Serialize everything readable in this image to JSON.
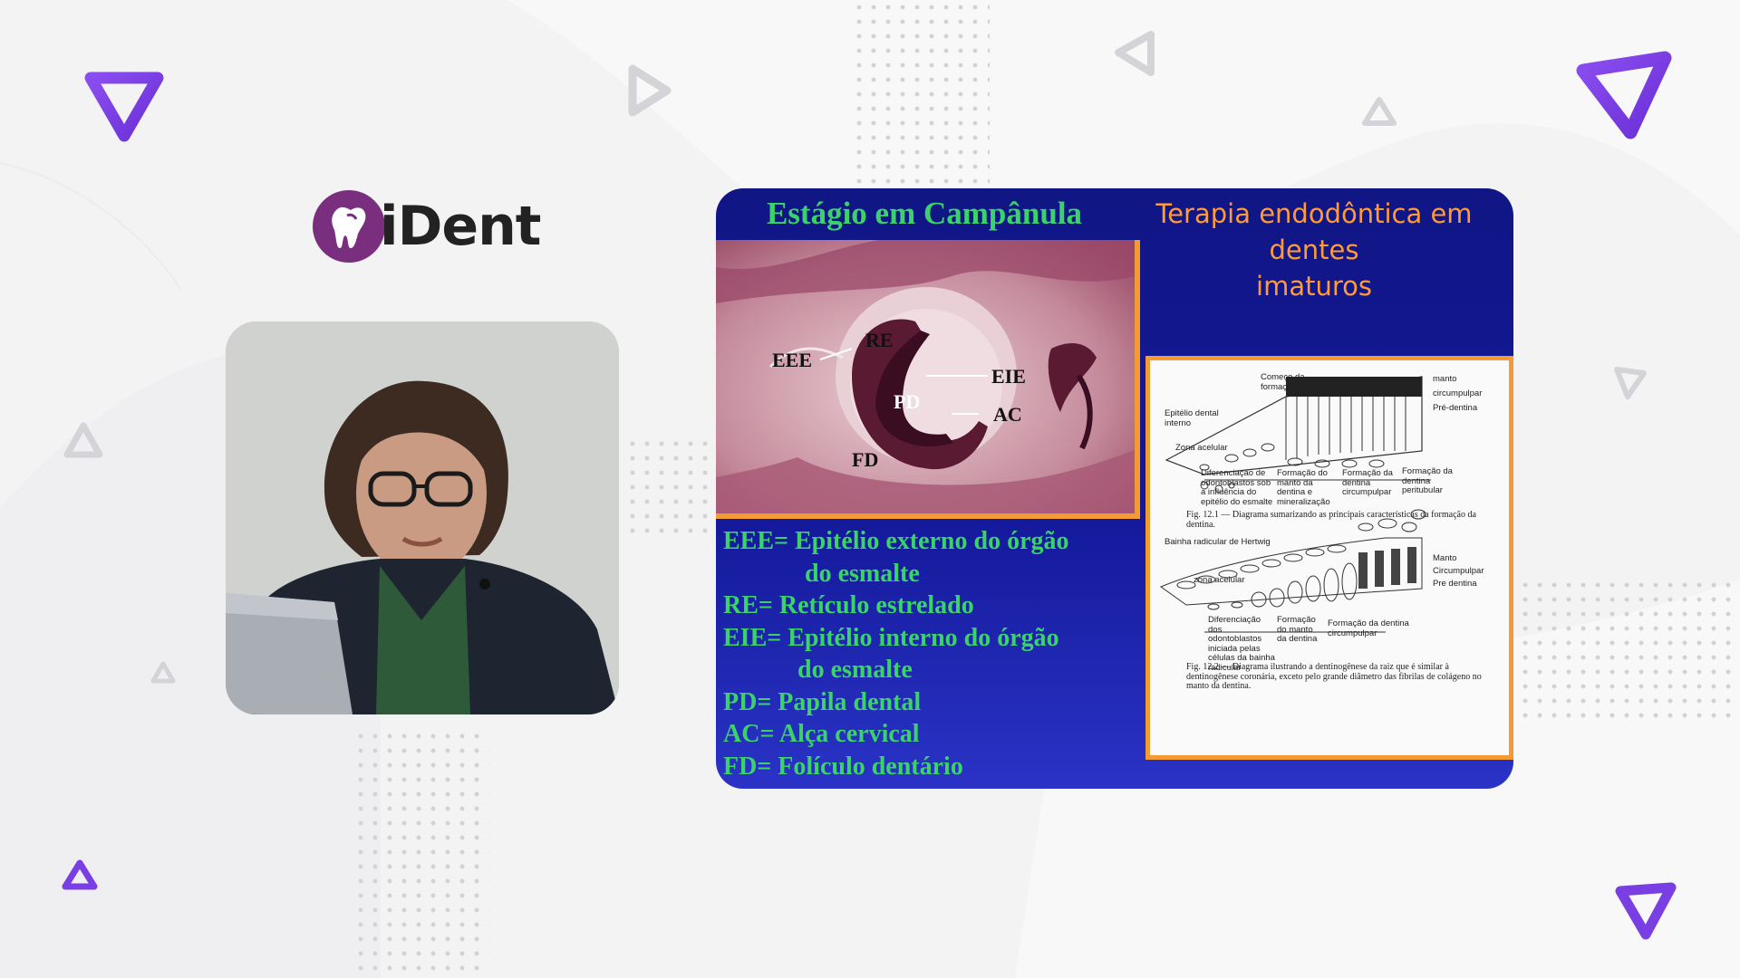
{
  "brand": {
    "name": "iDent",
    "accent": "#7b3fe4",
    "logo_color": "#7a2e7e"
  },
  "slide": {
    "title_left": "Estágio em Campânula",
    "title_right_line1": "Terapia endodôntica em dentes",
    "title_right_line2": "imaturos",
    "micro_labels": {
      "eee": "EEE",
      "re": "RE",
      "pd": "PD",
      "eie": "EIE",
      "ac": "AC",
      "fd": "FD"
    },
    "legend": [
      "EEE= Epitélio externo do órgão",
      "do esmalte",
      "RE= Retículo estrelado",
      "EIE= Epitélio interno do órgão",
      "do esmalte",
      "PD= Papila dental",
      "AC= Alça cervical",
      "FD= Folículo dentário"
    ],
    "diagram": {
      "comeco": "Começo da formação do esmalte",
      "manto": "manto",
      "circumpulpar": "circumpulpar",
      "predentina": "Pré-dentina",
      "epitelio": "Epitélio dental interno",
      "zona_acelular": "Zona acelular",
      "dif1": "Diferenciação de odontoblastos sob a influência do epitélio do esmalte",
      "form_manto": "Formação do manto da dentina e mineralização",
      "form_circ": "Formação da dentina circumpulpar",
      "form_peri": "Formação da dentina peritubular",
      "fig1": "Fig. 12.1 — Diagrama sumarizando as principais características da formação da dentina.",
      "bainha": "Bainha radicular de Hertwig",
      "manto2": "Manto",
      "circ2": "Circumpulpar",
      "pre2": "Pre dentina",
      "zona2": "zona acelular",
      "dif2": "Diferenciação dos odontoblastos iniciada pelas células da bainha radicular",
      "form_manto2": "Formação do manto da dentina",
      "form_circ2": "Formação da dentina circumpulpar",
      "fig2": "Fig. 12.2 — Diagrama ilustrando a dentinogênese da raiz que é similar à dentinogênese coronária, exceto pelo grande diâmetro das fibrilas de colágeno no manto da dentina."
    }
  }
}
